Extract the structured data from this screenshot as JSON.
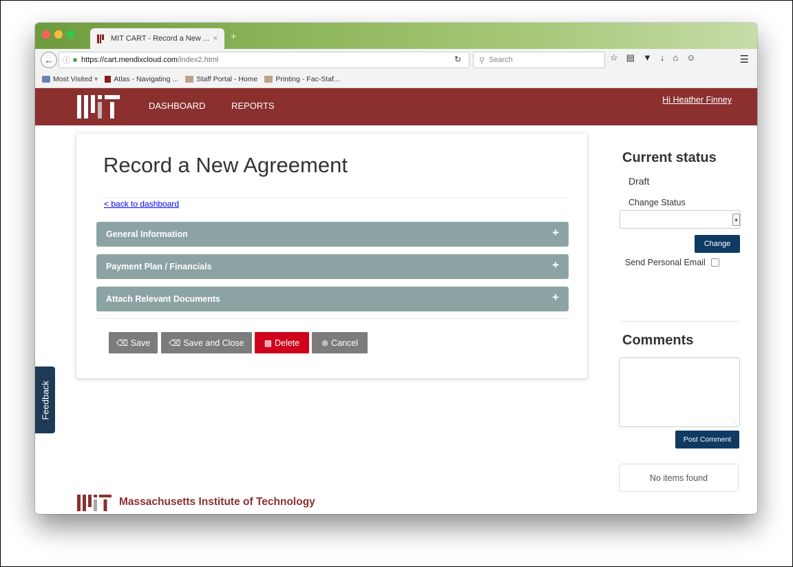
{
  "browser": {
    "tab_title": "MIT CART - Record a New ...",
    "tab_close": "×",
    "new_tab": "+",
    "url_host": "https://cart.mendixcloud.com",
    "url_path": "/index2.html",
    "search_placeholder": "Search",
    "bookmarks": [
      "Most Visited",
      "Atlas - Navigating ...",
      "Staff Portal - Home",
      "Printing - Fac-Staf..."
    ]
  },
  "header": {
    "nav": [
      "DASHBOARD",
      "REPORTS"
    ],
    "greeting": "Hi Heather Finney"
  },
  "main": {
    "title": "Record a New Agreement",
    "back_link": "< back to dashboard",
    "sections": [
      "General Information",
      "Payment Plan / Financials",
      "Attach Relevant Documents"
    ],
    "buttons": {
      "save": "Save",
      "save_close": "Save and Close",
      "delete": "Delete",
      "cancel": "Cancel"
    }
  },
  "sidebar": {
    "status_title": "Current status",
    "status_value": "Draft",
    "change_status_label": "Change Status",
    "change_button": "Change",
    "send_email_label": "Send Personal Email",
    "comments_title": "Comments",
    "post_button": "Post Comment",
    "empty_text": "No items found"
  },
  "feedback": "Feedback",
  "footer": {
    "name": "Massachusetts Institute of Technology"
  },
  "colors": {
    "brand": "#8b2f2f",
    "section": "#8ca3a3",
    "primary_button": "#0e3a63",
    "danger": "#d0021b",
    "neutral_button": "#7c7c7c"
  }
}
